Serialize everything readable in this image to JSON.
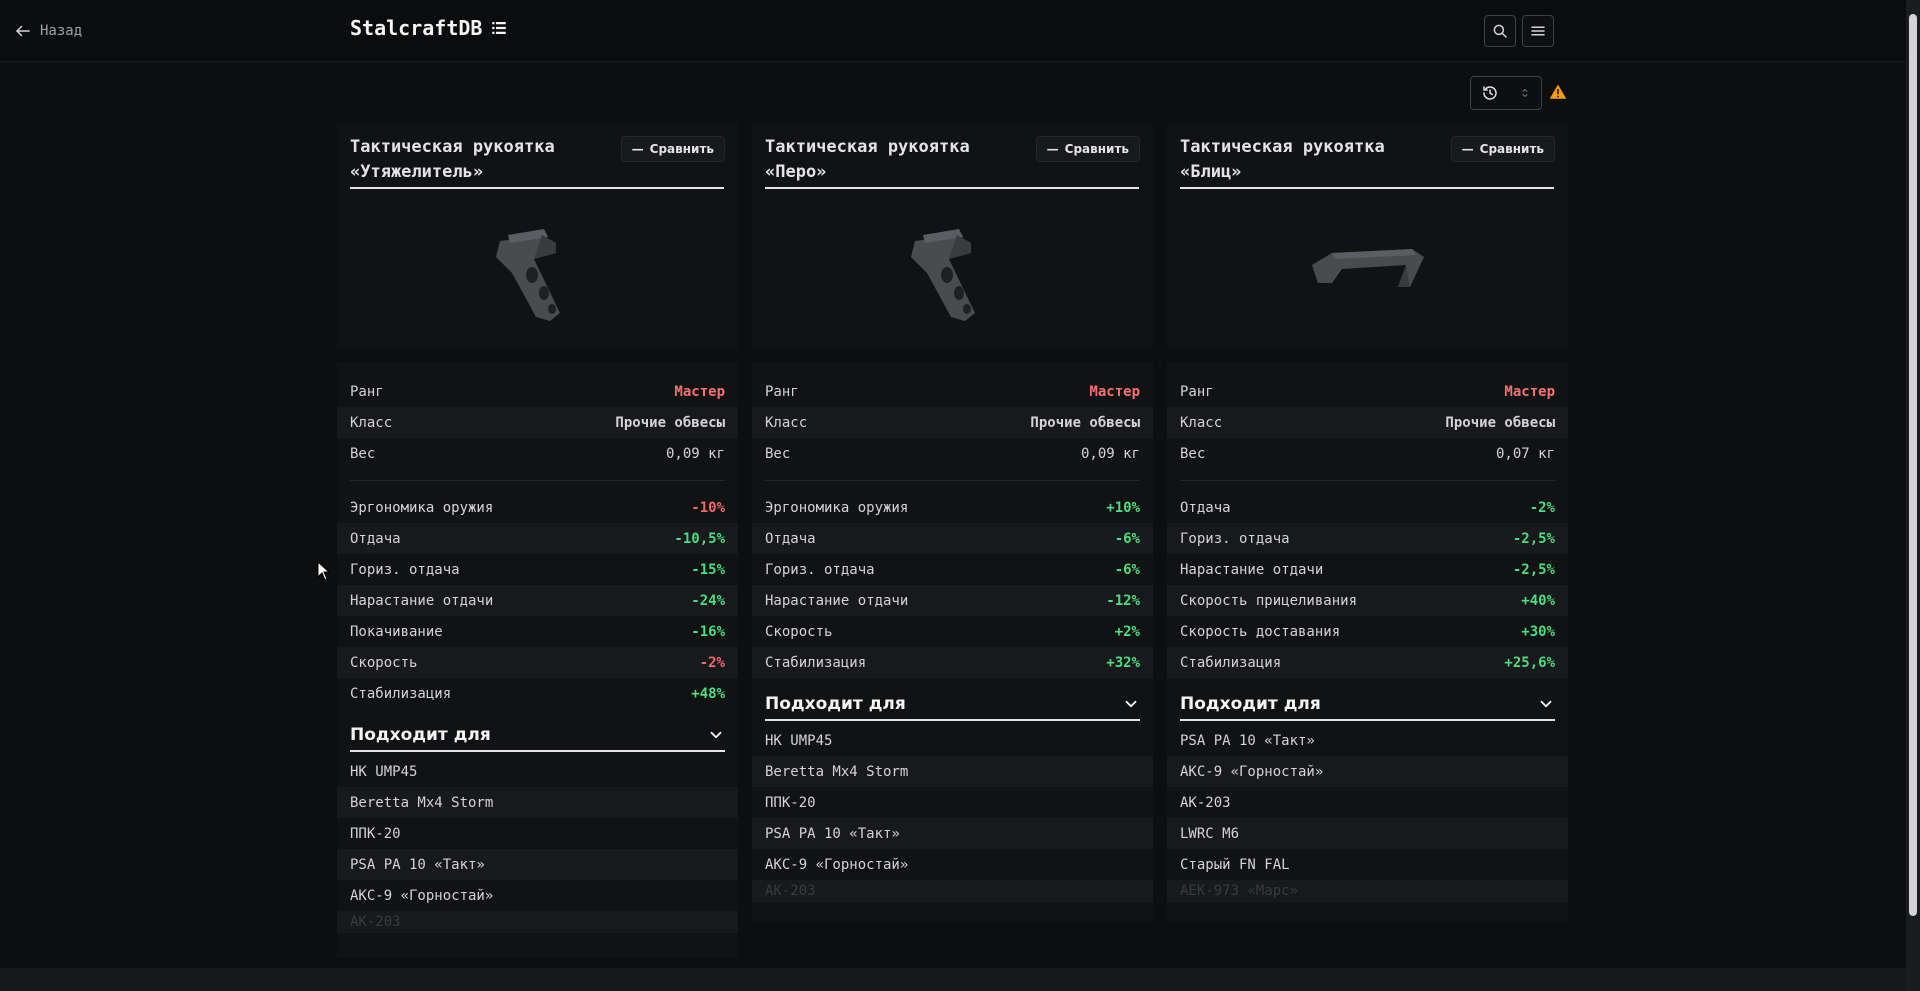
{
  "header": {
    "back_label": "Назад",
    "brand": "StalcraftDB"
  },
  "items": [
    {
      "title": "Тактическая рукоятка «Утяжелитель»",
      "compare_label": "Сравнить",
      "stats": [
        {
          "label": "Ранг",
          "value": "Мастер",
          "tone": "rank"
        },
        {
          "label": "Класс",
          "value": "Прочие обвесы",
          "tone": "muted"
        },
        {
          "label": "Вес",
          "value": "0,09 кг",
          "tone": "muted"
        }
      ],
      "effects": [
        {
          "label": "Эргономика оружия",
          "value": "-10%",
          "tone": "red"
        },
        {
          "label": "Отдача",
          "value": "-10,5%",
          "tone": "green"
        },
        {
          "label": "Гориз. отдача",
          "value": "-15%",
          "tone": "green"
        },
        {
          "label": "Нарастание отдачи",
          "value": "-24%",
          "tone": "green"
        },
        {
          "label": "Покачивание",
          "value": "-16%",
          "tone": "green"
        },
        {
          "label": "Скорость",
          "value": "-2%",
          "tone": "red"
        },
        {
          "label": "Стабилизация",
          "value": "+48%",
          "tone": "green"
        }
      ],
      "suits_label": "Подходит для",
      "suits": [
        "HK UMP45",
        "Beretta Mx4 Storm",
        "ППК-20",
        "PSA PA 10 «Такт»",
        "АКС-9 «Горностай»",
        "АК-203"
      ]
    },
    {
      "title": "Тактическая рукоятка «Перо»",
      "compare_label": "Сравнить",
      "stats": [
        {
          "label": "Ранг",
          "value": "Мастер",
          "tone": "rank"
        },
        {
          "label": "Класс",
          "value": "Прочие обвесы",
          "tone": "muted"
        },
        {
          "label": "Вес",
          "value": "0,09 кг",
          "tone": "muted"
        }
      ],
      "effects": [
        {
          "label": "Эргономика оружия",
          "value": "+10%",
          "tone": "green"
        },
        {
          "label": "Отдача",
          "value": "-6%",
          "tone": "green"
        },
        {
          "label": "Гориз. отдача",
          "value": "-6%",
          "tone": "green"
        },
        {
          "label": "Нарастание отдачи",
          "value": "-12%",
          "tone": "green"
        },
        {
          "label": "Скорость",
          "value": "+2%",
          "tone": "green"
        },
        {
          "label": "Стабилизация",
          "value": "+32%",
          "tone": "green"
        }
      ],
      "suits_label": "Подходит для",
      "suits": [
        "HK UMP45",
        "Beretta Mx4 Storm",
        "ППК-20",
        "PSA PA 10 «Такт»",
        "АКС-9 «Горностай»",
        "АК-203"
      ]
    },
    {
      "title": "Тактическая рукоятка «Блиц»",
      "compare_label": "Сравнить",
      "stats": [
        {
          "label": "Ранг",
          "value": "Мастер",
          "tone": "rank"
        },
        {
          "label": "Класс",
          "value": "Прочие обвесы",
          "tone": "muted"
        },
        {
          "label": "Вес",
          "value": "0,07 кг",
          "tone": "muted"
        }
      ],
      "effects": [
        {
          "label": "Отдача",
          "value": "-2%",
          "tone": "green"
        },
        {
          "label": "Гориз. отдача",
          "value": "-2,5%",
          "tone": "green"
        },
        {
          "label": "Нарастание отдачи",
          "value": "-2,5%",
          "tone": "green"
        },
        {
          "label": "Скорость прицеливания",
          "value": "+40%",
          "tone": "green"
        },
        {
          "label": "Скорость доставания",
          "value": "+30%",
          "tone": "green"
        },
        {
          "label": "Стабилизация",
          "value": "+25,6%",
          "tone": "green"
        }
      ],
      "suits_label": "Подходит для",
      "suits": [
        "PSA PA 10 «Такт»",
        "АКС-9 «Горностай»",
        "АК-203",
        "LWRC M6",
        "Старый FN FAL",
        "АЕК-973 «Марс»"
      ]
    }
  ],
  "icons": {
    "back": "arrow-left-icon",
    "brand": "list-icon",
    "search": "search-icon",
    "menu": "menu-icon",
    "history": "history-icon",
    "sort": "chevron-up-down-icon",
    "warning": "warning-icon",
    "compare": "minus-icon",
    "collapse": "chevron-down-icon"
  },
  "colors": {
    "background": "#0d0e10",
    "panel": "#111214",
    "rank": "#f87171",
    "positive": "#4ade80",
    "negative": "#f06a6a",
    "warning": "#f59e0b"
  }
}
